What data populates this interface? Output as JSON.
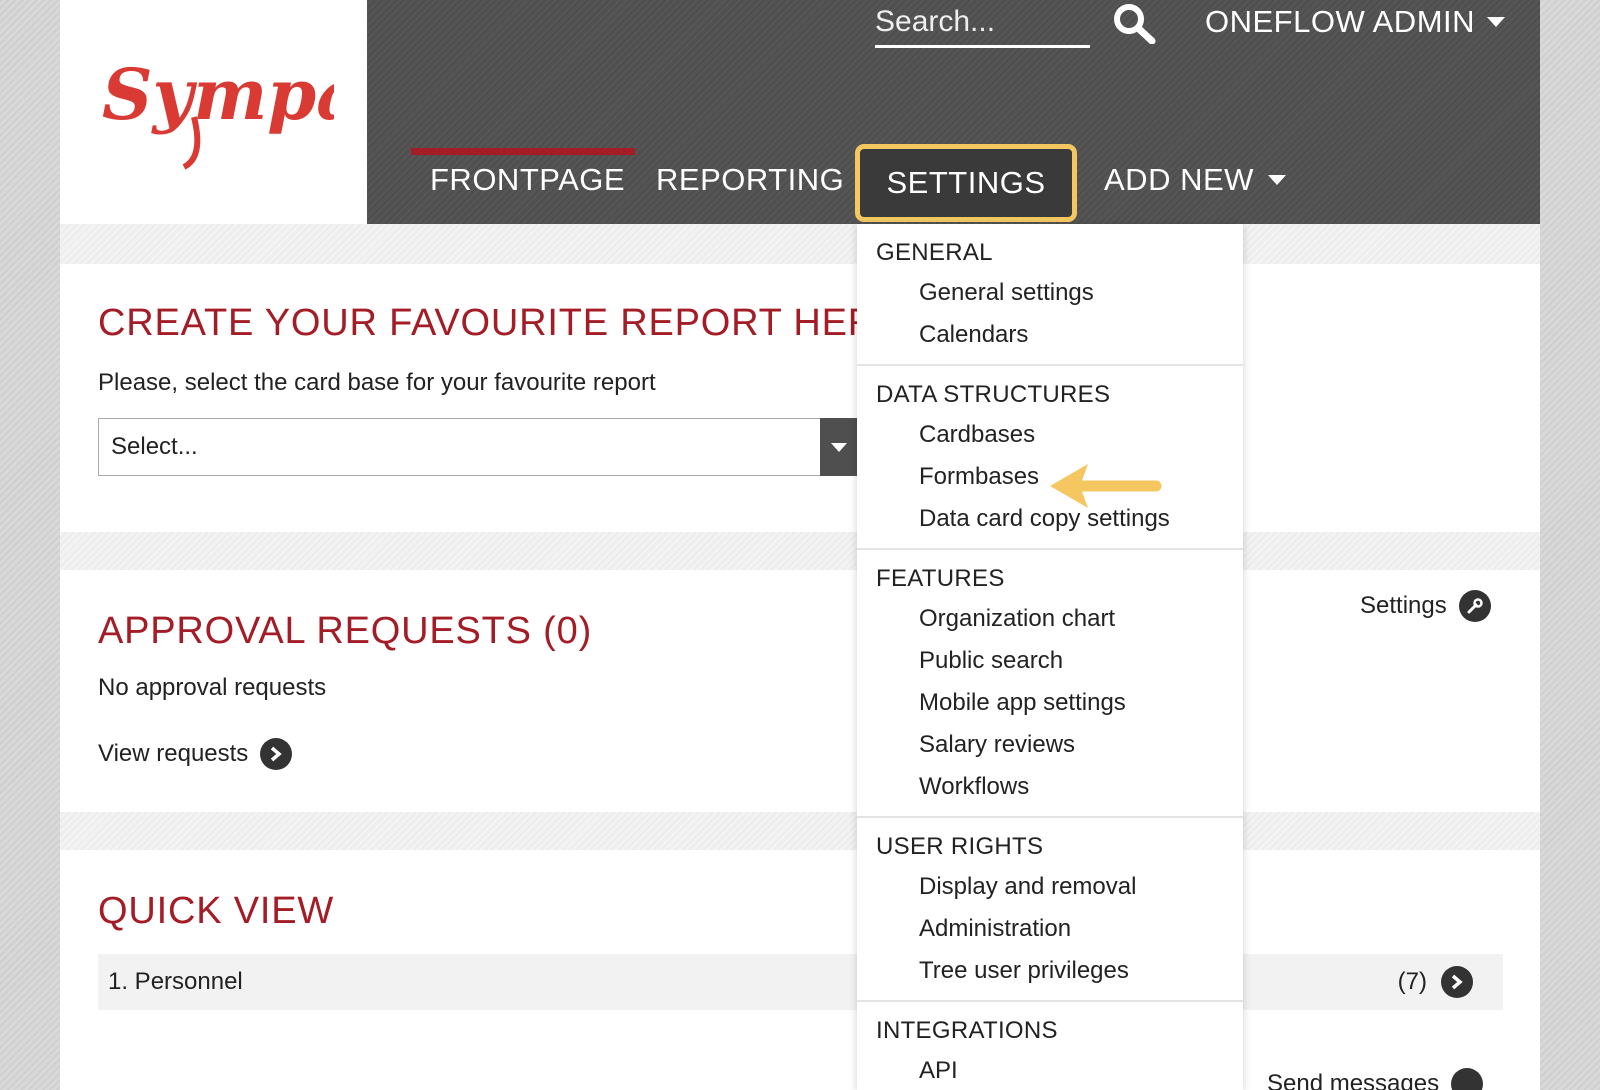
{
  "header": {
    "logo_text": "Sympa",
    "search_placeholder": "Search...",
    "user_menu_label": "ONEFLOW ADMIN"
  },
  "nav": {
    "items": [
      "FRONTPAGE",
      "REPORTING",
      "SETTINGS",
      "ADD NEW"
    ],
    "active": "FRONTPAGE",
    "highlighted": "SETTINGS"
  },
  "favourite_report": {
    "title": "CREATE YOUR FAVOURITE REPORT HERE",
    "instruction": "Please, select the card base for your favourite report",
    "select_value": "Select..."
  },
  "approval": {
    "title": "APPROVAL REQUESTS (0)",
    "empty_text": "No approval requests",
    "view_link": "View requests",
    "settings_link": "Settings"
  },
  "quick_view": {
    "title": "QUICK VIEW",
    "rows": [
      {
        "label": "1. Personnel",
        "count": "(7)"
      }
    ],
    "send_messages": "Send messages"
  },
  "settings_menu": {
    "sections": [
      {
        "heading": "GENERAL",
        "items": [
          "General settings",
          "Calendars"
        ]
      },
      {
        "heading": "DATA STRUCTURES",
        "items": [
          "Cardbases",
          "Formbases",
          "Data card copy settings"
        ]
      },
      {
        "heading": "FEATURES",
        "items": [
          "Organization chart",
          "Public search",
          "Mobile app settings",
          "Salary reviews",
          "Workflows"
        ]
      },
      {
        "heading": "USER RIGHTS",
        "items": [
          "Display and removal",
          "Administration",
          "Tree user privileges"
        ]
      },
      {
        "heading": "INTEGRATIONS",
        "items": [
          "API"
        ]
      }
    ]
  },
  "colors": {
    "brand_red": "#a31c26",
    "header_bg": "#505050",
    "highlight_yellow": "#f5c760"
  }
}
